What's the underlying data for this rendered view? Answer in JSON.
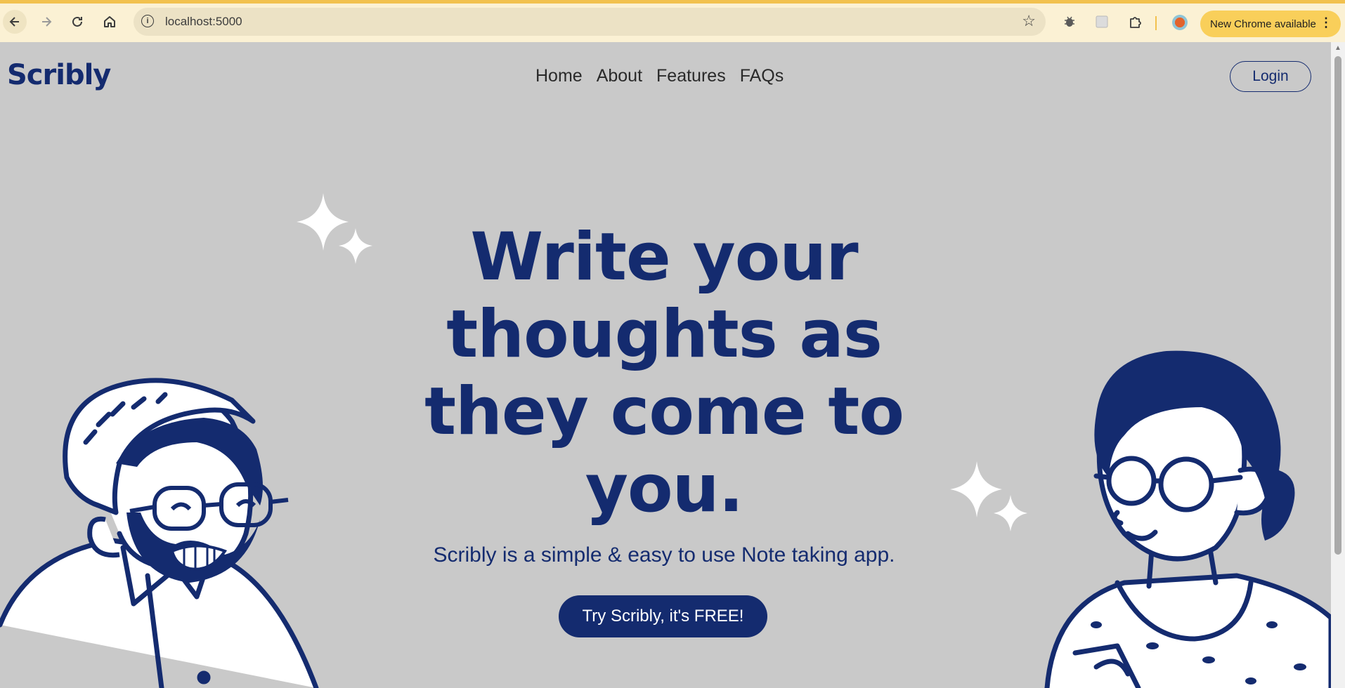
{
  "browser": {
    "url": "localhost:5000",
    "update_label": "New Chrome available",
    "icons": {
      "back": "arrow-left-icon",
      "forward": "arrow-right-icon",
      "reload": "reload-icon",
      "home": "home-icon",
      "site_info": "info-icon",
      "bookmark": "star-icon",
      "extensions": [
        "bug-icon",
        "puzzle-icon"
      ],
      "menu": "more-vertical-icon"
    }
  },
  "site": {
    "logo": "Scribly",
    "nav": [
      "Home",
      "About",
      "Features",
      "FAQs"
    ],
    "login_label": "Login",
    "hero": {
      "line1": "Write your",
      "line2": "thoughts as",
      "line3": "they come to",
      "line4": "you.",
      "subtitle": "Scribly is a simple & easy to use Note taking app.",
      "cta_label": "Try Scribly, it's FREE!"
    }
  },
  "colors": {
    "brand_navy": "#142b6f",
    "page_bg": "#c9c9c9",
    "chrome_bg": "#fbf1d4",
    "update_pill": "#f9cf5a"
  }
}
